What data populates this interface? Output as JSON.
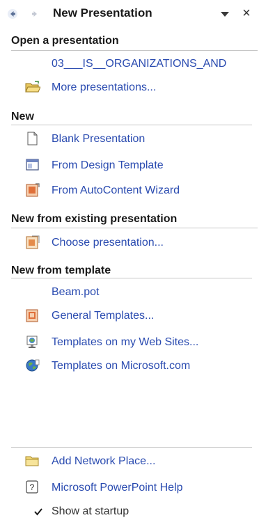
{
  "header": {
    "title": "New Presentation",
    "close_glyph": "×"
  },
  "sections": {
    "open": {
      "heading": "Open a presentation",
      "recent_file": "03___IS__ORGANIZATIONS_AND",
      "more_label": "More presentations..."
    },
    "new": {
      "heading": "New",
      "blank_label": "Blank Presentation",
      "design_template_label": "From Design Template",
      "autocontent_label": "From AutoContent Wizard"
    },
    "existing": {
      "heading": "New from existing presentation",
      "choose_label": "Choose presentation..."
    },
    "template": {
      "heading": "New from template",
      "recent_template": "Beam.pot",
      "general_label": "General Templates...",
      "web_sites_label": "Templates on my Web Sites...",
      "microsoft_label": "Templates on Microsoft.com"
    }
  },
  "footer": {
    "network_label": "Add Network Place...",
    "help_label": "Microsoft PowerPoint Help",
    "startup_label": "Show at startup",
    "startup_checked": true
  },
  "colors": {
    "link": "#2a4bb0",
    "rule": "#c6c6c6",
    "heading": "#1a1a1a"
  },
  "icons": {
    "back": "back-arrow-icon",
    "forward": "forward-arrow-icon",
    "dropdown": "dropdown-triangle-icon",
    "close": "close-icon",
    "open_folder": "open-folder-icon",
    "blank": "blank-page-icon",
    "design_template": "design-template-icon",
    "autocontent": "autocontent-wizard-icon",
    "choose": "existing-presentation-icon",
    "general": "general-templates-icon",
    "web_sites": "web-sites-icon",
    "microsoft": "globe-icon",
    "network": "network-folder-icon",
    "help": "help-icon",
    "checkbox": "checkbox-icon"
  }
}
